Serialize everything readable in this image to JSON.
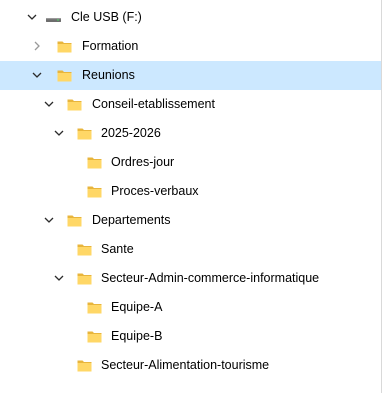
{
  "tree": {
    "nodes": [
      {
        "label": "Cle USB (F:)",
        "icon": "usb-drive-icon",
        "chevron": "expanded"
      },
      {
        "label": "Formation",
        "icon": "folder-icon",
        "chevron": "collapsed"
      },
      {
        "label": "Reunions",
        "icon": "folder-icon",
        "chevron": "expanded",
        "selected": true
      },
      {
        "label": "Conseil-etablissement",
        "icon": "folder-icon",
        "chevron": "expanded"
      },
      {
        "label": "2025-2026",
        "icon": "folder-icon",
        "chevron": "expanded"
      },
      {
        "label": "Ordres-jour",
        "icon": "folder-icon",
        "chevron": "none"
      },
      {
        "label": "Proces-verbaux",
        "icon": "folder-icon",
        "chevron": "none"
      },
      {
        "label": "Departements",
        "icon": "folder-icon",
        "chevron": "expanded"
      },
      {
        "label": "Sante",
        "icon": "folder-icon",
        "chevron": "none"
      },
      {
        "label": "Secteur-Admin-commerce-informatique",
        "icon": "folder-icon",
        "chevron": "expanded"
      },
      {
        "label": "Equipe-A",
        "icon": "folder-icon",
        "chevron": "none"
      },
      {
        "label": "Equipe-B",
        "icon": "folder-icon",
        "chevron": "none"
      },
      {
        "label": "Secteur-Alimentation-tourisme",
        "icon": "folder-icon",
        "chevron": "none"
      }
    ]
  },
  "colors": {
    "selection_background": "#cce8ff",
    "folder_fill": "#ffd766",
    "folder_back": "#e8b53c",
    "chevron_color": "#2b2b2b"
  }
}
